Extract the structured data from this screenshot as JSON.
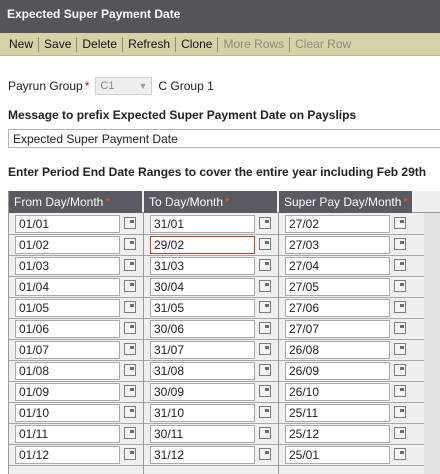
{
  "window": {
    "title": "Expected Super Payment Date"
  },
  "toolbar": {
    "new_label": "New",
    "save_label": "Save",
    "delete_label": "Delete",
    "refresh_label": "Refresh",
    "clone_label": "Clone",
    "more_rows_label": "More Rows",
    "clear_row_label": "Clear Row"
  },
  "form": {
    "payrun_group_label": "Payrun Group",
    "required_marker": "*",
    "payrun_group_value": "C1",
    "payrun_group_name": "C Group 1",
    "message_label": "Message to prefix Expected Super Payment Date on Payslips",
    "message_value": "Expected Super Payment Date",
    "ranges_label": "Enter Period End Date Ranges to cover the entire year including Feb 29th"
  },
  "grid": {
    "columns": [
      "From Day/Month",
      "To Day/Month",
      "Super Pay Day/Month"
    ],
    "rows": [
      [
        "01/01",
        "31/01",
        "27/02"
      ],
      [
        "01/02",
        "29/02",
        "27/03"
      ],
      [
        "01/03",
        "31/03",
        "27/04"
      ],
      [
        "01/04",
        "30/04",
        "27/05"
      ],
      [
        "01/05",
        "31/05",
        "27/06"
      ],
      [
        "01/06",
        "30/06",
        "27/07"
      ],
      [
        "01/07",
        "31/07",
        "26/08"
      ],
      [
        "01/08",
        "31/08",
        "26/09"
      ],
      [
        "01/09",
        "30/09",
        "26/10"
      ],
      [
        "01/10",
        "31/10",
        "25/11"
      ],
      [
        "01/11",
        "30/11",
        "25/12"
      ],
      [
        "01/12",
        "31/12",
        "25/01"
      ]
    ]
  },
  "colors": {
    "title_bar": "#54555b",
    "toolbar": "#d4d2a6",
    "header": "#5a5b62",
    "required": "#dd0000"
  }
}
